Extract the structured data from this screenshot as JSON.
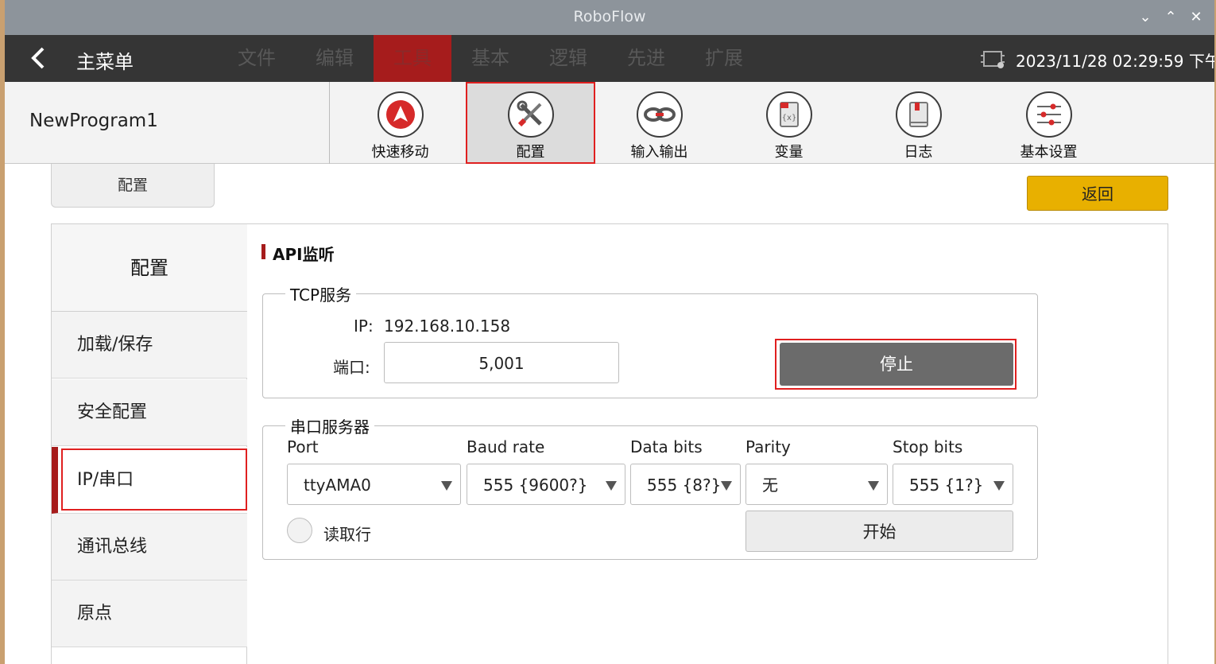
{
  "window": {
    "title": "RoboFlow",
    "min_glyph": "⌄",
    "max_glyph": "⌃",
    "close_glyph": "✕"
  },
  "menubar": {
    "title": "主菜单",
    "tabs": [
      "文件",
      "编辑",
      "工具",
      "基本",
      "逻辑",
      "先进",
      "扩展"
    ],
    "active_tab": "工具",
    "datetime": "2023/11/28 02:29:59 下午"
  },
  "toolbar": {
    "program_name": "NewProgram1",
    "tools": [
      {
        "label": "快速移动",
        "icon": "quick-move-icon"
      },
      {
        "label": "配置",
        "icon": "wrench-screwdriver-icon"
      },
      {
        "label": "输入输出",
        "icon": "io-link-icon"
      },
      {
        "label": "变量",
        "icon": "variable-icon"
      },
      {
        "label": "日志",
        "icon": "log-book-icon"
      },
      {
        "label": "基本设置",
        "icon": "sliders-icon"
      }
    ],
    "selected_tool": "配置"
  },
  "tab_header": "配置",
  "return_label": "返回",
  "sidebar": {
    "header": "配置",
    "items": [
      "加载/保存",
      "安全配置",
      "IP/串口",
      "通讯总线",
      "原点"
    ],
    "active": "IP/串口"
  },
  "section_title": "API监听",
  "tcp": {
    "legend": "TCP服务",
    "ip_label": "IP:",
    "ip_value": "192.168.10.158",
    "port_label": "端口:",
    "port_value": "5,001",
    "stop_label": "停止"
  },
  "serial": {
    "legend": "串口服务器",
    "columns": [
      "Port",
      "Baud rate",
      "Data bits",
      "Parity",
      "Stop bits"
    ],
    "values": [
      "ttyAMA0",
      "555 {9600?}",
      "555 {8?}",
      "无",
      "555 {1?}"
    ],
    "read_line_label": "读取行",
    "start_label": "开始"
  },
  "colors": {
    "accent_red": "#a61c1c",
    "return_yellow": "#e8b000",
    "highlight": "#e02020"
  }
}
